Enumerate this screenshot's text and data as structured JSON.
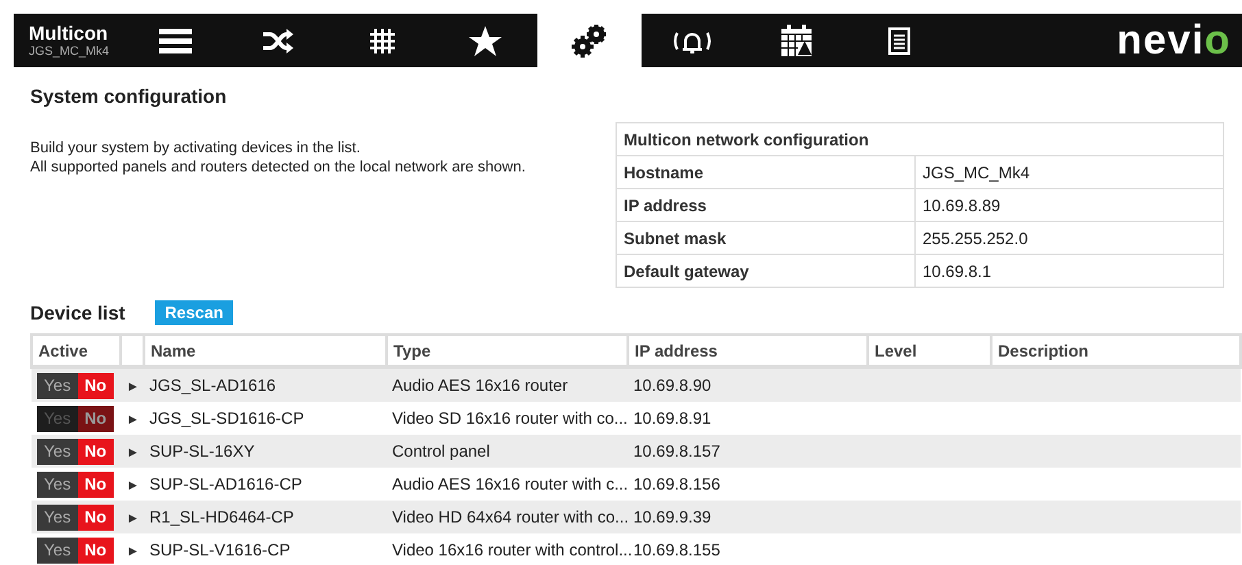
{
  "app": {
    "title": "Multicon",
    "subtitle": "JGS_MC_Mk4",
    "logo": "nevio"
  },
  "nav": [
    {
      "kind": "list",
      "selected": false
    },
    {
      "kind": "shuffle",
      "selected": false
    },
    {
      "kind": "grid",
      "selected": false
    },
    {
      "kind": "star",
      "selected": false
    },
    {
      "kind": "gears",
      "selected": true
    },
    {
      "kind": "alarm",
      "selected": false
    },
    {
      "kind": "calendar",
      "selected": false
    },
    {
      "kind": "document",
      "selected": false
    }
  ],
  "page_title": "System configuration",
  "intro": [
    "Build your system by activating devices in the list.",
    "All supported panels and routers detected on the local network are shown."
  ],
  "network": {
    "title": "Multicon network configuration",
    "rows": [
      {
        "label": "Hostname",
        "value": "JGS_MC_Mk4"
      },
      {
        "label": "IP address",
        "value": "10.69.8.89"
      },
      {
        "label": "Subnet mask",
        "value": "255.255.252.0"
      },
      {
        "label": "Default gateway",
        "value": "10.69.8.1"
      }
    ]
  },
  "device_list": {
    "title": "Device list",
    "rescan": "Rescan",
    "columns": [
      "Active",
      "Name",
      "Type",
      "IP address",
      "Level",
      "Description"
    ],
    "rows": [
      {
        "yes": "Yes",
        "no": "No",
        "active": false,
        "disabled": false,
        "arrow": "►",
        "name": "JGS_SL-AD1616",
        "type": "Audio AES 16x16 router",
        "ip": "10.69.8.90"
      },
      {
        "yes": "Yes",
        "no": "No",
        "active": false,
        "disabled": true,
        "arrow": "►",
        "name": "JGS_SL-SD1616-CP",
        "type": "Video SD 16x16 router with co...",
        "ip": "10.69.8.91"
      },
      {
        "yes": "Yes",
        "no": "No",
        "active": false,
        "disabled": false,
        "arrow": "►",
        "name": "SUP-SL-16XY",
        "type": "Control panel",
        "ip": "10.69.8.157"
      },
      {
        "yes": "Yes",
        "no": "No",
        "active": false,
        "disabled": false,
        "arrow": "►",
        "name": "SUP-SL-AD1616-CP",
        "type": "Audio AES 16x16 router with c...",
        "ip": "10.69.8.156"
      },
      {
        "yes": "Yes",
        "no": "No",
        "active": false,
        "disabled": false,
        "arrow": "►",
        "name": "R1_SL-HD6464-CP",
        "type": "Video HD 64x64 router with co...",
        "ip": "10.69.9.39"
      },
      {
        "yes": "Yes",
        "no": "No",
        "active": false,
        "disabled": false,
        "arrow": "►",
        "name": "SUP-SL-V1616-CP",
        "type": "Video 16x16 router with control...",
        "ip": "10.69.8.155"
      }
    ]
  }
}
